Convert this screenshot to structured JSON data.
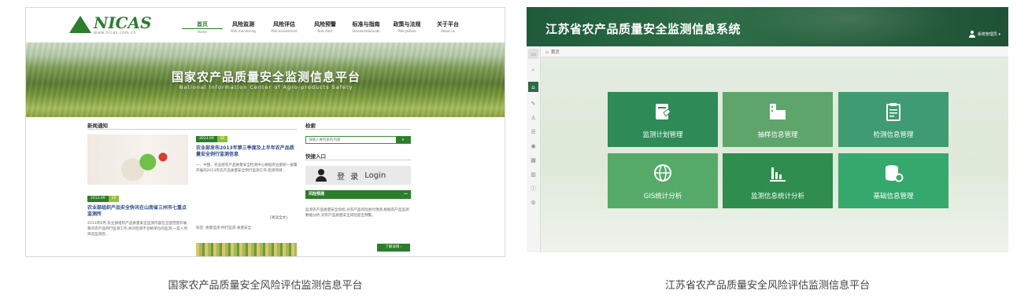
{
  "left_site": {
    "logo": {
      "text": "NICAS",
      "subtext": "www.nicas.com.cn"
    },
    "nav": [
      {
        "cn": "首页",
        "en": "Home"
      },
      {
        "cn": "风险监测",
        "en": "Risk monitoring"
      },
      {
        "cn": "风险评估",
        "en": "Risk assessment"
      },
      {
        "cn": "风险预警",
        "en": "Risk Alert"
      },
      {
        "cn": "标准与指南",
        "en": "Standards&Guide"
      },
      {
        "cn": "政策与法规",
        "en": "Policy&Rule"
      },
      {
        "cn": "关于平台",
        "en": "About us"
      }
    ],
    "banner": {
      "title": "国家农产品质量安全监测信息平台",
      "subtitle": "National Information Center of Agro-products Safety"
    },
    "news": {
      "section_title": "新闻通知",
      "item1": {
        "date": "2013.09",
        "tag": "20",
        "headline": "农业部组织产品安全快讯在山南省三州市七重点监测所",
        "body": "2013年9月,农业部组织产品质量安全监测内容在全国范围开展重点农产品例行监测工作,并对检测不合格单位的监测,一是入项目选监测后...",
        "more": "[阅读全文]"
      },
      "item2": {
        "date": "2013.09",
        "tag": "20",
        "headline": "农业部发布2013年第三季度及上半年农产品质量安全例行监测信息",
        "body": "一、中国、农业部农产品质量安全检测中心根据农业部统一部署开展的2013年农产品质量安全例行监测工作,检测项目...",
        "more": "[阅读全文]",
        "tags_line": "标签: 质量监测 例行监测 质量安全"
      }
    },
    "sidebar": {
      "search_title": "检索",
      "search_placeholder": "请输入要检索的内容",
      "search_icon": "magnifier",
      "login_title": "快捷入口",
      "login_label": "登 录",
      "login_en": "Login",
      "risk_title": "风险预测",
      "risk_minus": "—",
      "risk_text": "监测农产品质量安全指标,对农产品风险进行预测,根据农产品监测数据分析,对农产品质量安全风险提出预警。",
      "risk_button": "了解详情 ›"
    }
  },
  "right_app": {
    "title": "江苏省农产品质量安全监测信息系统",
    "user_label": "系统管理员 ▾",
    "tab_label": "首页",
    "sidebar_icons": [
      "collapse-icon",
      "search-icon",
      "home-icon",
      "report-icon",
      "user-icon",
      "table-icon",
      "circle-icon",
      "grid-icon",
      "chart-icon",
      "info-icon",
      "settings-icon"
    ],
    "tiles": [
      {
        "label": "监测计划管理",
        "icon": "plan-icon"
      },
      {
        "label": "抽样信息管理",
        "icon": "building-icon"
      },
      {
        "label": "检测信息管理",
        "icon": "clipboard-icon"
      },
      {
        "label": "GIS统计分析",
        "icon": "globe-icon"
      },
      {
        "label": "监测信息统计分析",
        "icon": "bar-chart-icon"
      },
      {
        "label": "基础信息管理",
        "icon": "database-settings-icon"
      }
    ]
  },
  "captions": {
    "left": "国家农产品质量安全风险评估监测信息平台",
    "right": "江苏省农产品质量安全风险评估监测信息平台"
  }
}
